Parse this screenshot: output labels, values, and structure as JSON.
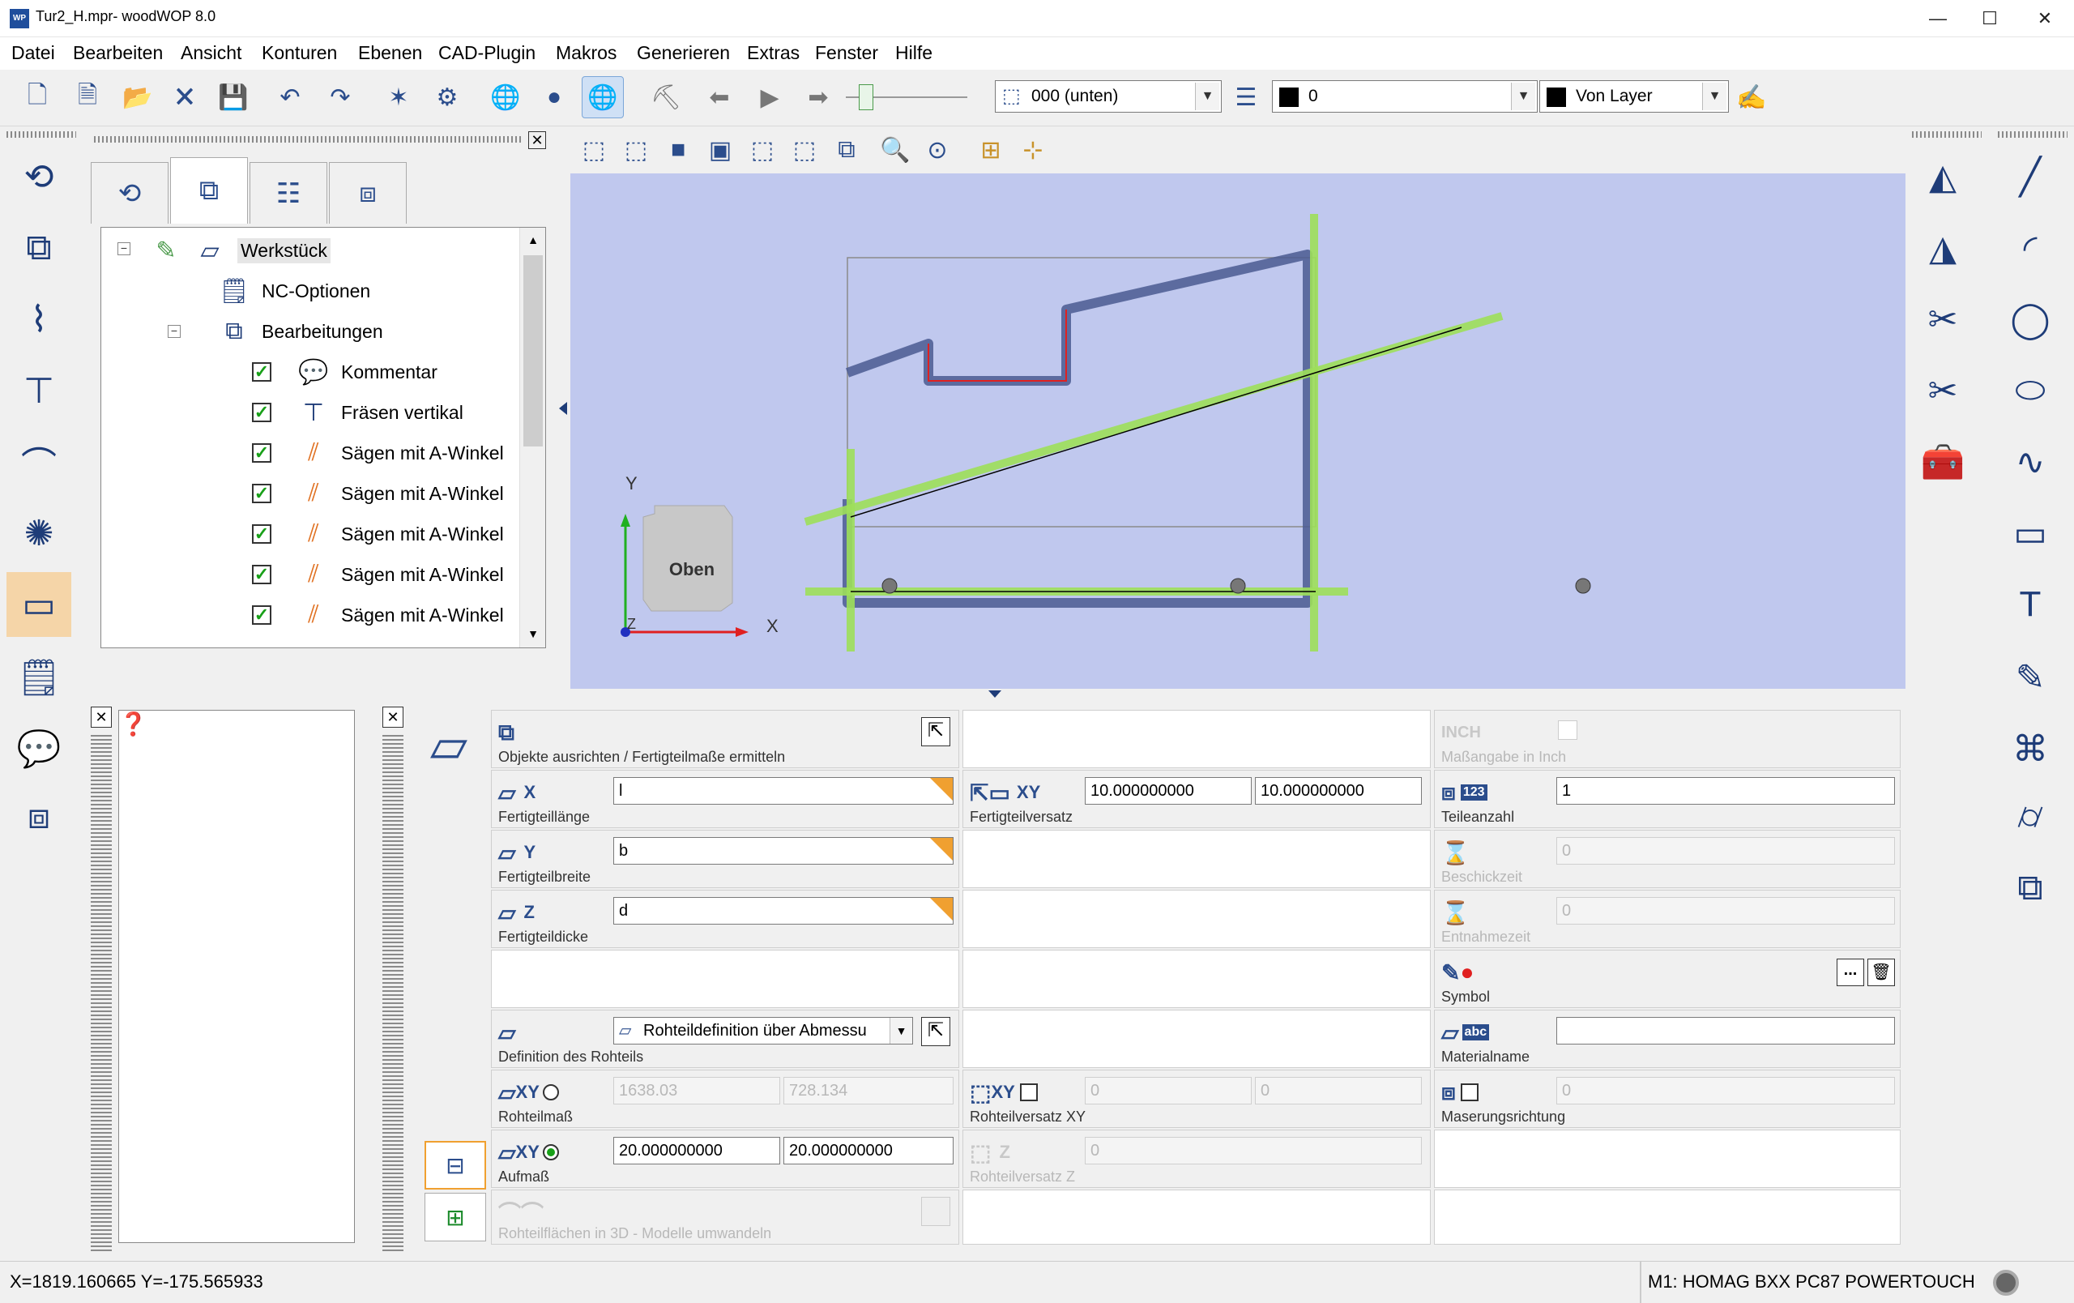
{
  "window": {
    "title": "Tur2_H.mpr- woodWOP 8.0",
    "app_icon_text": "WP",
    "minimize": "—",
    "maximize": "☐",
    "close": "✕"
  },
  "menu": [
    "Datei",
    "Bearbeiten",
    "Ansicht",
    "Konturen",
    "Ebenen",
    "CAD-Plugin",
    "Makros",
    "Generieren",
    "Extras",
    "Fenster",
    "Hilfe"
  ],
  "toolbar": {
    "layer_combo": "000  (unten)",
    "color_combo": "0",
    "linetype_combo": "Von Layer"
  },
  "tree": {
    "tabs": [
      "contour-tab",
      "machining-tab",
      "variables-tab",
      "components-tab"
    ],
    "items": [
      {
        "label": "Werkstück",
        "checked": null
      },
      {
        "label": "NC-Optionen",
        "checked": null
      },
      {
        "label": "Bearbeitungen",
        "checked": null
      },
      {
        "label": "Kommentar",
        "checked": true
      },
      {
        "label": "Fräsen vertikal",
        "checked": true
      },
      {
        "label": "Sägen mit A-Winkel",
        "checked": true
      },
      {
        "label": "Sägen mit A-Winkel",
        "checked": true
      },
      {
        "label": "Sägen mit A-Winkel",
        "checked": true
      },
      {
        "label": "Sägen mit A-Winkel",
        "checked": true
      },
      {
        "label": "Sägen mit A-Winkel",
        "checked": true
      }
    ],
    "check_mark": "✓"
  },
  "viewport": {
    "view_cube_label": "Oben",
    "axis_x": "X",
    "axis_y": "Y",
    "axis_z": "Z"
  },
  "props": {
    "align": {
      "label": "Objekte ausrichten / Fertigteilmaße ermitteln"
    },
    "inch": {
      "label": "Maßangabe in Inch",
      "icon_text": "INCH"
    },
    "length": {
      "label": "Fertigteillänge",
      "axis": "X",
      "value": "l"
    },
    "width": {
      "label": "Fertigteilbreite",
      "axis": "Y",
      "value": "b"
    },
    "thickness": {
      "label": "Fertigteildicke",
      "axis": "Z",
      "value": "d"
    },
    "offset": {
      "label": "Fertigteilversatz",
      "axis": "XY",
      "x": "10.000000000",
      "y": "10.000000000"
    },
    "count": {
      "label": "Teileanzahl",
      "icon_text": "123",
      "value": "1"
    },
    "coating_time": {
      "label": "Beschickzeit",
      "value": "0"
    },
    "removal_time": {
      "label": "Entnahmezeit",
      "value": "0"
    },
    "symbol": {
      "label": "Symbol",
      "button": "..."
    },
    "raw_def": {
      "label": "Definition des Rohteils",
      "value": "Rohteildefinition über Abmessu"
    },
    "material": {
      "label": "Materialname",
      "icon_text": "abc",
      "value": ""
    },
    "raw_size": {
      "label": "Rohteilmaß",
      "axis": "XY",
      "x": "1638.03",
      "y": "728.134"
    },
    "raw_offset_xy": {
      "label": "Rohteilversatz XY",
      "axis": "XY",
      "x": "0",
      "y": "0"
    },
    "grain": {
      "label": "Maserungsrichtung",
      "value": "0"
    },
    "allowance": {
      "label": "Aufmaß",
      "axis": "XY",
      "x": "20.000000000",
      "y": "20.000000000"
    },
    "raw_offset_z": {
      "label": "Rohteilversatz Z",
      "axis": "Z",
      "value": "0"
    },
    "convert_3d": {
      "label": "Rohteilflächen in 3D - Modelle umwandeln"
    }
  },
  "status": {
    "coords": "X=1819.160665 Y=-175.565933",
    "machine": "M1: HOMAG BXX PC87 POWERTOUCH"
  },
  "colors": {
    "viewport_bg": "#c0c8ee",
    "contour_green": "#9ee05a",
    "contour_blue": "#4a5a90",
    "accent_orange": "#f0a030"
  }
}
